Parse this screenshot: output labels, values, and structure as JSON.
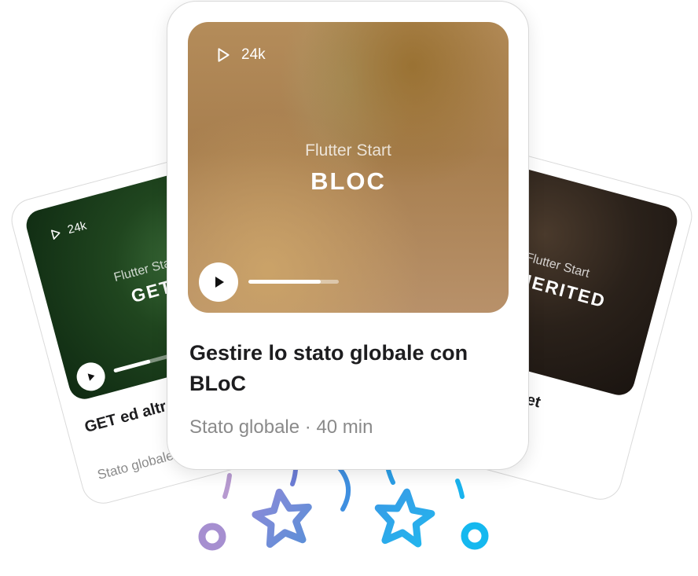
{
  "colors": {
    "accent_purple": "#9b86c9",
    "accent_blue": "#3aa7e6",
    "accent_cyan": "#19b6ef",
    "star_lavender": "#7f8fd6"
  },
  "cards": {
    "left": {
      "views": "24k",
      "brand": "Flutter Start",
      "course": "GET",
      "title": "GET ed altre librerie per",
      "meta": "Stato globale",
      "progress": 0.6
    },
    "center": {
      "views": "24k",
      "brand": "Flutter Start",
      "course": "BLOC",
      "title": "Gestire lo stato globale con BLoC",
      "meta": "Stato globale · 40 min",
      "progress": 0.8
    },
    "right": {
      "brand": "Flutter Start",
      "course": "INHERITED",
      "title": "InheritedWidget"
    }
  },
  "icons": {
    "views": "play-outline-icon",
    "play": "play-icon"
  }
}
